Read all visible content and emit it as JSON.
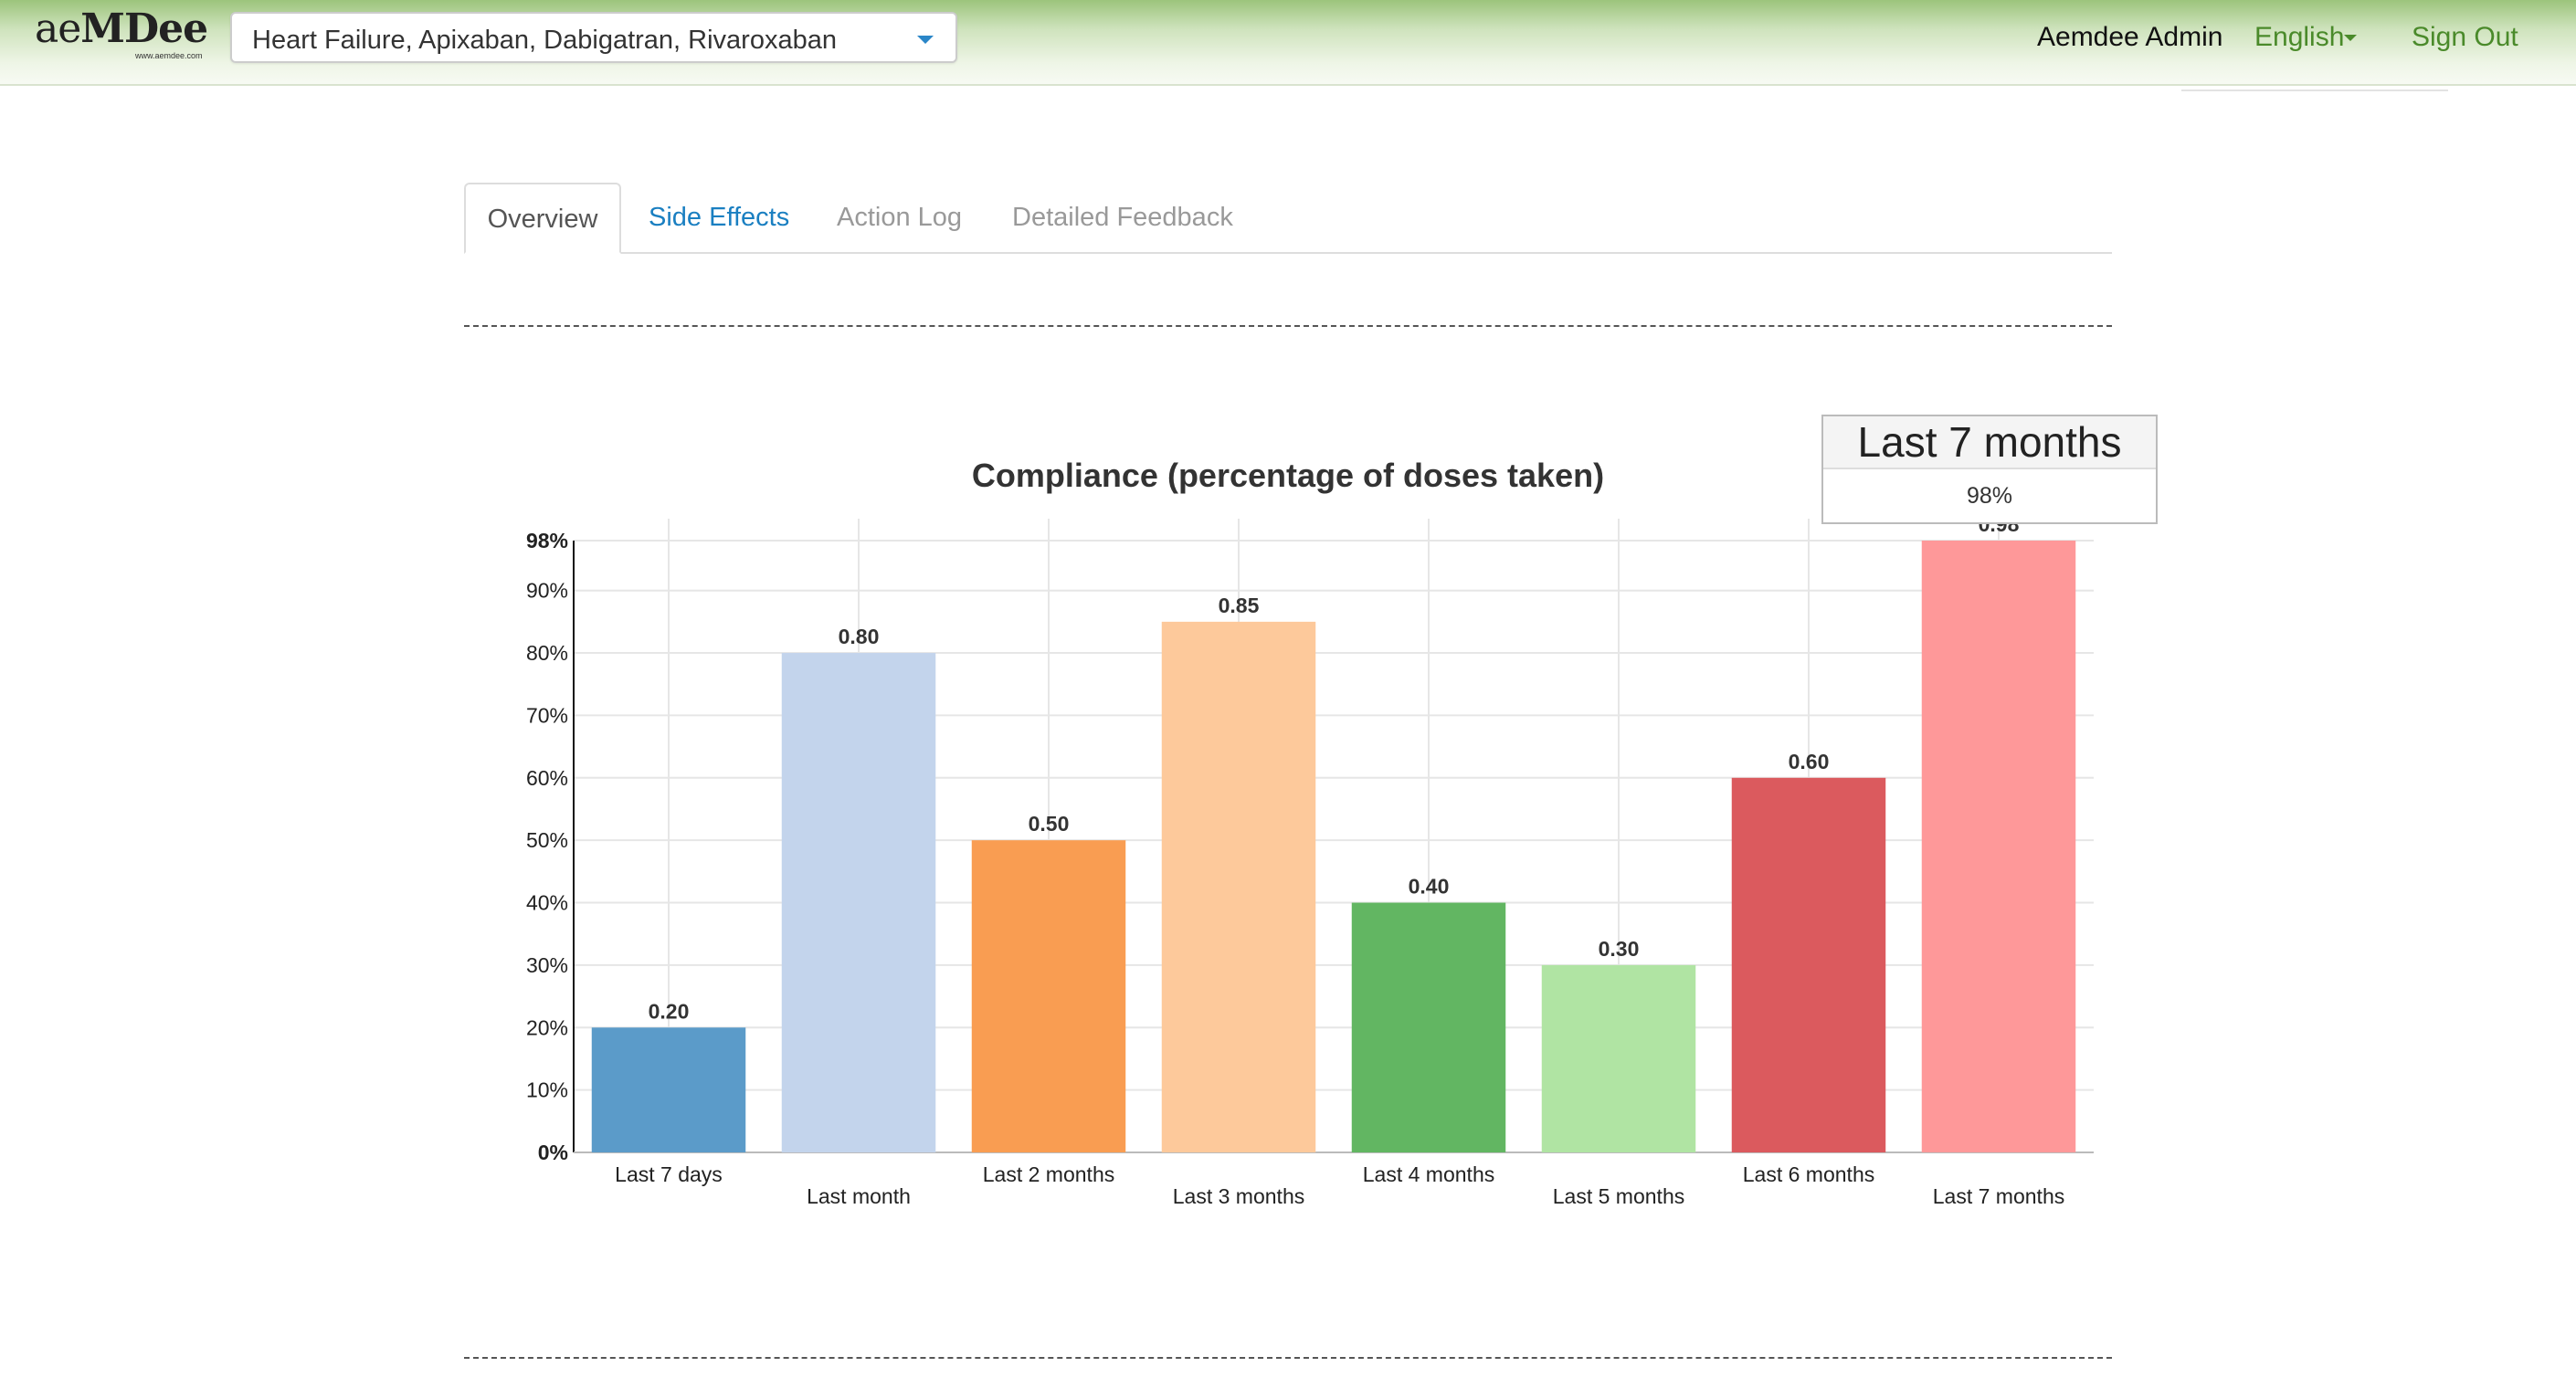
{
  "header": {
    "logo_text_ae": "ae",
    "logo_text_mdee": "MDee",
    "logo_sub": "www.aemdee.com",
    "selector_value": "Heart Failure, Apixaban, Dabigatran, Rivaroxaban",
    "user_name": "Aemdee Admin",
    "language": "English",
    "sign_out": "Sign Out"
  },
  "tabs": [
    {
      "label": "Overview",
      "active": true
    },
    {
      "label": "Side Effects",
      "active": false
    },
    {
      "label": "Action Log",
      "active": false
    },
    {
      "label": "Detailed Feedback",
      "active": false
    }
  ],
  "tooltip": {
    "title": "Last 7 months",
    "value": "98%"
  },
  "chart_data": {
    "type": "bar",
    "title": "Compliance (percentage of doses taken)",
    "categories": [
      "Last 7 days",
      "Last month",
      "Last 2 months",
      "Last 3 months",
      "Last 4 months",
      "Last 5 months",
      "Last 6 months",
      "Last 7 months"
    ],
    "values": [
      0.2,
      0.8,
      0.5,
      0.85,
      0.4,
      0.3,
      0.6,
      0.98
    ],
    "value_labels": [
      "0.20",
      "0.80",
      "0.50",
      "0.85",
      "0.40",
      "0.30",
      "0.60",
      "0.98"
    ],
    "colors": [
      "#5b9bc9",
      "#c3d4ec",
      "#f99d52",
      "#fdc99b",
      "#62b662",
      "#b0e4a3",
      "#db5a5e",
      "#fe9899"
    ],
    "ylim": [
      0,
      0.98
    ],
    "yticks": [
      0,
      0.1,
      0.2,
      0.3,
      0.4,
      0.5,
      0.6,
      0.7,
      0.8,
      0.9,
      0.98
    ],
    "ytick_labels": [
      "0%",
      "10%",
      "20%",
      "30%",
      "40%",
      "50%",
      "60%",
      "70%",
      "80%",
      "90%",
      "98%"
    ],
    "grid": true,
    "xlabel": "",
    "ylabel": ""
  }
}
